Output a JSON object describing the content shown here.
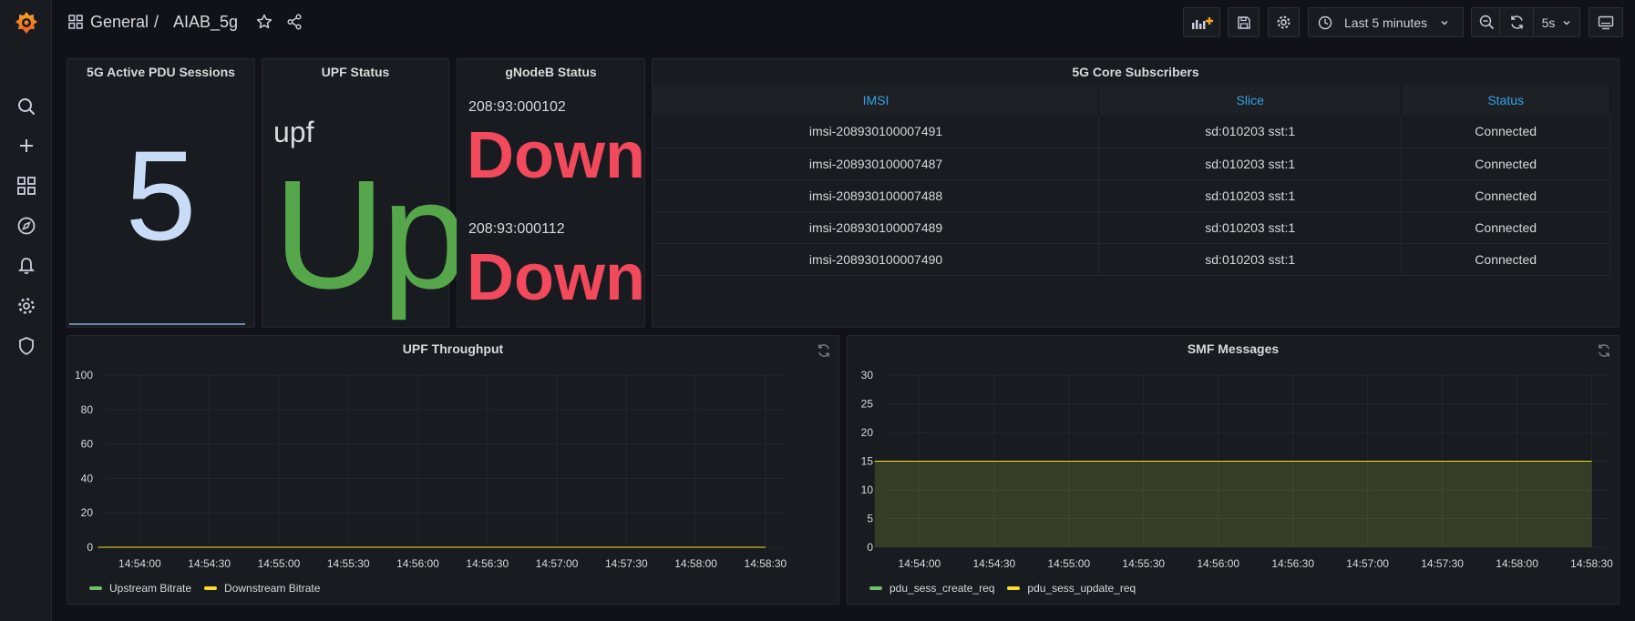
{
  "nav": {
    "icons": [
      "grafana-logo-icon",
      "search-icon",
      "plus-icon",
      "dashboards-icon",
      "explore-icon",
      "alerting-icon",
      "configuration-icon",
      "server-admin-icon"
    ]
  },
  "breadcrumb": {
    "folder": "General",
    "separator": "/",
    "title": "AIAB_5g"
  },
  "toolbar": {
    "time_range": "Last 5 minutes",
    "refresh_interval": "5s"
  },
  "panels": {
    "pdu_sessions": {
      "title": "5G Active PDU Sessions",
      "value": "5"
    },
    "upf_status": {
      "title": "UPF Status",
      "name": "upf",
      "value": "Up"
    },
    "gnodeb_status": {
      "title": "gNodeB Status",
      "items": [
        {
          "name": "208:93:000102",
          "value": "Down"
        },
        {
          "name": "208:93:000112",
          "value": "Down"
        }
      ]
    },
    "subscribers": {
      "title": "5G Core Subscribers",
      "columns": [
        "IMSI",
        "Slice",
        "Status"
      ],
      "rows": [
        [
          "imsi-208930100007491",
          "sd:010203 sst:1",
          "Connected"
        ],
        [
          "imsi-208930100007487",
          "sd:010203 sst:1",
          "Connected"
        ],
        [
          "imsi-208930100007488",
          "sd:010203 sst:1",
          "Connected"
        ],
        [
          "imsi-208930100007489",
          "sd:010203 sst:1",
          "Connected"
        ],
        [
          "imsi-208930100007490",
          "sd:010203 sst:1",
          "Connected"
        ]
      ]
    },
    "upf_throughput": {
      "title": "UPF Throughput"
    },
    "smf_messages": {
      "title": "SMF Messages"
    }
  },
  "colors": {
    "up": "#56a64b",
    "down": "#f2495c",
    "stat_blue": "#c8dcf7",
    "header_blue": "#33a2e5",
    "series_green": "#73bf69",
    "series_yellow": "#fade2a"
  },
  "chart_data": [
    {
      "type": "line",
      "title": "UPF Throughput",
      "x": [
        "14:54:00",
        "14:54:30",
        "14:55:00",
        "14:55:30",
        "14:56:00",
        "14:56:30",
        "14:57:00",
        "14:57:30",
        "14:58:00",
        "14:58:30"
      ],
      "yticks": [
        0,
        20,
        40,
        60,
        80,
        100
      ],
      "ylim": [
        0,
        100
      ],
      "series": [
        {
          "name": "Upstream Bitrate",
          "color": "#73bf69",
          "values": [
            0,
            0,
            0,
            0,
            0,
            0,
            0,
            0,
            0,
            0
          ]
        },
        {
          "name": "Downstream Bitrate",
          "color": "#fade2a",
          "values": [
            0,
            0,
            0,
            0,
            0,
            0,
            0,
            0,
            0,
            0
          ]
        }
      ],
      "grid": true,
      "legend": "bottom-left"
    },
    {
      "type": "area",
      "title": "SMF Messages",
      "x": [
        "14:54:00",
        "14:54:30",
        "14:55:00",
        "14:55:30",
        "14:56:00",
        "14:56:30",
        "14:57:00",
        "14:57:30",
        "14:58:00",
        "14:58:30"
      ],
      "yticks": [
        0,
        5,
        10,
        15,
        20,
        25,
        30
      ],
      "ylim": [
        0,
        30
      ],
      "series": [
        {
          "name": "pdu_sess_create_req",
          "color": "#73bf69",
          "values": [
            15,
            15,
            15,
            15,
            15,
            15,
            15,
            15,
            15,
            15
          ]
        },
        {
          "name": "pdu_sess_update_req",
          "color": "#fade2a",
          "values": [
            15,
            15,
            15,
            15,
            15,
            15,
            15,
            15,
            15,
            15
          ]
        }
      ],
      "grid": true,
      "legend": "bottom-left"
    }
  ]
}
